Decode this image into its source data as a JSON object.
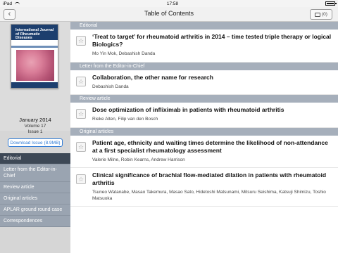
{
  "status": {
    "device": "iPad",
    "time": "17:58"
  },
  "nav": {
    "back_glyph": "‹",
    "title": "Table of Contents",
    "cart_count": "(0)"
  },
  "issue": {
    "cover_title": "International Journal of Rheumatic Diseases",
    "date": "January 2014",
    "volume": "Volume 17",
    "issue": "Issue 1",
    "download_label": "Download Issue (8.9MB)"
  },
  "sidebar": {
    "items": [
      {
        "label": "Editorial",
        "active": true
      },
      {
        "label": "Letter from the Editor-in-Chief",
        "active": false
      },
      {
        "label": "Review article",
        "active": false
      },
      {
        "label": "Original articles",
        "active": false
      },
      {
        "label": "APLAR ground round case",
        "active": false
      },
      {
        "label": "Correspondences",
        "active": false
      }
    ]
  },
  "toc": {
    "sections": [
      {
        "header": "Editorial",
        "articles": [
          {
            "title": "‘Treat to target’ for rheumatoid arthritis in 2014 – time tested triple therapy or logical Biologics?",
            "authors": "Mo Yin Mok, Debashish Danda"
          }
        ]
      },
      {
        "header": "Letter from the Editor-in-Chief",
        "articles": [
          {
            "title": "Collaboration, the other name for research",
            "authors": "Debashish Danda"
          }
        ]
      },
      {
        "header": "Review article",
        "articles": [
          {
            "title": "Dose optimization of infliximab in patients with rheumatoid arthritis",
            "authors": "Rieke Alten, Filip van den Bosch"
          }
        ]
      },
      {
        "header": "Original articles",
        "articles": [
          {
            "title": "Patient age, ethnicity and waiting times determine the likelihood of non-attendance at a first specialist rheumatology assessment",
            "authors": "Valerie Milne, Robin Kearns, Andrew Harrison"
          },
          {
            "title": "Clinical significance of brachial flow-mediated dilation in patients with rheumatoid arthritis",
            "authors": "Tsuneo Watanabe, Masao Takemura, Masao Sato, Hidetoshi Matsunami, Mitsuru Seishima, Katsuji Shimizu, Toshio Matsuoka"
          }
        ]
      }
    ]
  },
  "icons": {
    "back": "back-chevron-icon",
    "cart": "cart-icon",
    "star": "star-icon",
    "wifi": "wifi-icon",
    "battery": "battery-icon"
  },
  "colors": {
    "sidebar_active": "#3d4856",
    "sidebar_item": "#9aa4b1",
    "section_header": "#a6afbb",
    "accent": "#2e7bd6"
  }
}
